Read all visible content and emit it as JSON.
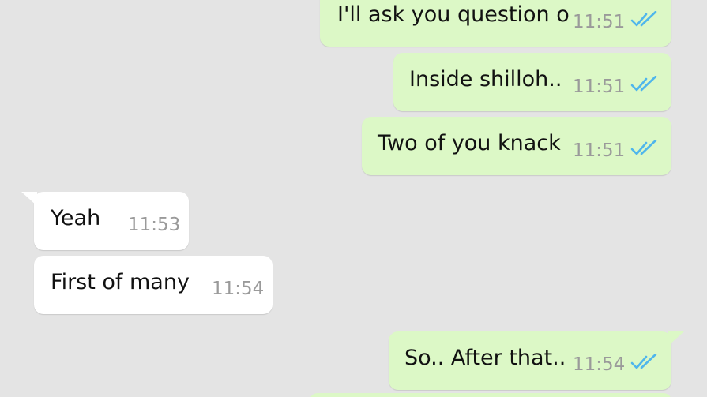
{
  "chat": {
    "background_color": "#e4e4e4",
    "outgoing_color": "#dcf8c6",
    "incoming_color": "#ffffff",
    "read_tick_color": "#4fb6ec",
    "messages": [
      {
        "direction": "outgoing",
        "text": "I'll ask you question o",
        "time": "11:51",
        "status": "read"
      },
      {
        "direction": "outgoing",
        "text": "Inside shilloh..",
        "time": "11:51",
        "status": "read"
      },
      {
        "direction": "outgoing",
        "text": "Two of you knack",
        "time": "11:51",
        "status": "read"
      },
      {
        "direction": "incoming",
        "text": "Yeah",
        "time": "11:53"
      },
      {
        "direction": "incoming",
        "text": "First of many",
        "time": "11:54"
      },
      {
        "direction": "outgoing",
        "text": "So.. After that..",
        "time": "11:54",
        "status": "read"
      }
    ]
  }
}
